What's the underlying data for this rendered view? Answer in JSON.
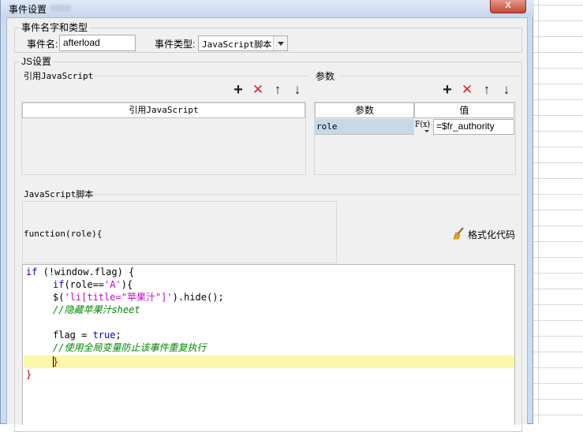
{
  "window": {
    "title": "事件设置",
    "close_label": "X"
  },
  "event_group": {
    "legend": "事件名字和类型",
    "name_label": "事件名:",
    "name_value": "afterload",
    "type_label": "事件类型:",
    "type_value": "JavaScript脚本"
  },
  "js_group": {
    "legend": "JS设置",
    "ref_legend": "引用JavaScript",
    "ref_header": "引用JavaScript",
    "params_legend": "参数",
    "params_headers": [
      "参数",
      "值"
    ],
    "params_rows": [
      {
        "name": "role",
        "fx_label": "F(x)",
        "value": "=$fr_authority"
      }
    ],
    "toolbar_icons": [
      "add-icon",
      "delete-icon",
      "move-up-icon",
      "move-down-icon"
    ],
    "script_legend": "JavaScript脚本",
    "function_signature": "function(role){",
    "format_button_label": "格式化代码"
  },
  "code": {
    "l1_kw": "if",
    "l1_rest": " (!window.flag) {",
    "l2_kw": "if",
    "l2_a": "(role==",
    "l2_str": "'A'",
    "l2_b": "){",
    "l3_a": "$(",
    "l3_str1": "'li[title=\"",
    "l3_str2": "苹果汁",
    "l3_str3": "\"]'",
    "l3_b": ").hide();",
    "l4_cmt": "//隐藏苹果汁sheet",
    "l6_a": "flag = ",
    "l6_kw": "true",
    "l6_b": ";",
    "l7_cmt": "//使用全局变量防止该事件重复执行",
    "l8": "}",
    "l9": "}"
  },
  "colors": {
    "keyword": "#0000cc",
    "string": "#cc00cc",
    "comment": "#008800",
    "brace": "#cc0000",
    "current_line": "#fbf7a8",
    "selected_row": "#c5d9e9"
  }
}
